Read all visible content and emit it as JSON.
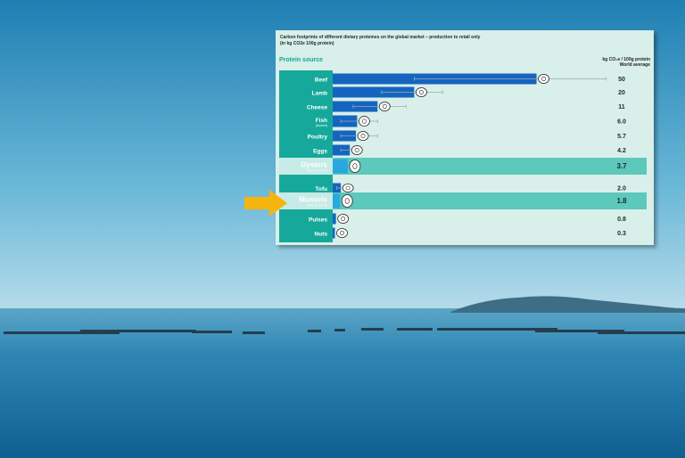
{
  "chart_data": {
    "type": "bar",
    "title": "Carbon footprints of different dietary proteines on the global market – production to retail only",
    "subtitle": "(in kg CO2e 100g protein)",
    "category_header": "Protein source",
    "unit_label": "kg CO₂e / 100g protein",
    "value_header": "World  average",
    "categories": [
      "Beef",
      "Lamb",
      "Cheese",
      "Fish",
      "Poultry",
      "Eggs",
      "Oysters",
      "Tofu",
      "Mussels",
      "Pulses",
      "Nuts"
    ],
    "sublabels": [
      "",
      "",
      "",
      "(farmed)",
      "",
      "",
      "(New Zealand)",
      "",
      "(New Zealand)",
      "",
      ""
    ],
    "values": [
      50,
      20,
      11,
      6.0,
      5.7,
      4.2,
      3.7,
      2.0,
      1.8,
      0.8,
      0.3
    ],
    "value_labels": [
      "50",
      "20",
      "11",
      "6.0",
      "5.7",
      "4.2",
      "3.7",
      "2.0",
      "1.8",
      "0.8",
      "0.3"
    ],
    "highlighted": [
      "Oysters",
      "Mussels"
    ],
    "arrow_points_to": "Mussels",
    "error_ranges": [
      [
        20,
        67
      ],
      [
        12,
        27
      ],
      [
        5,
        18
      ],
      [
        2,
        11
      ],
      [
        2,
        11
      ],
      [
        2,
        6
      ],
      null,
      [
        1,
        3
      ],
      null,
      null,
      null
    ],
    "xlim": [
      0,
      70
    ],
    "grid": false,
    "colors": {
      "bar": "#1565c0",
      "label_column": "#16a99b",
      "highlight_row": "#4fc3b7",
      "highlight_bar": "#29a8e0",
      "panel_bg": "#d9efe9",
      "arrow": "#f6b40e"
    },
    "icons": [
      "steak-icon",
      "lamb-chop-icon",
      "cheese-icon",
      "fish-icon",
      "drumstick-icon",
      "egg-icon",
      "oyster-icon",
      "tofu-icon",
      "mussel-icon",
      "pulses-icon",
      "nuts-icon"
    ]
  }
}
